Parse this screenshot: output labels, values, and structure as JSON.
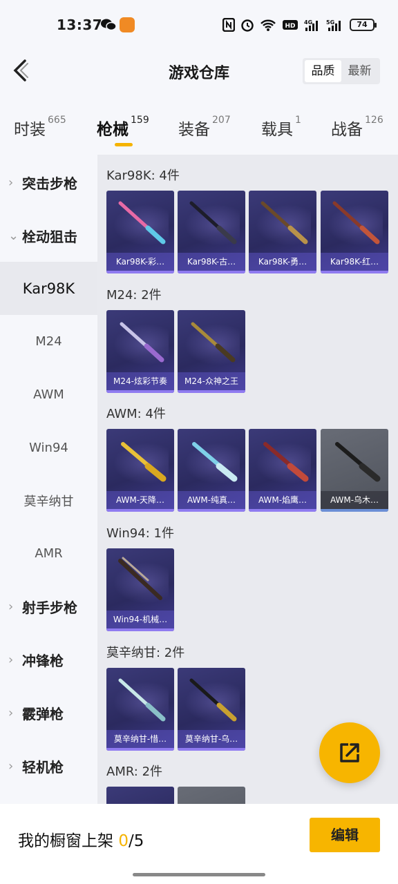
{
  "status_bar": {
    "time": "13:37",
    "battery": "74",
    "icons": [
      "wechat-icon",
      "fox-app-icon",
      "nfc-icon",
      "alarm-icon",
      "wifi-icon",
      "hd-icon",
      "signal-4g-icon",
      "signal-5g-icon",
      "battery-icon"
    ]
  },
  "header": {
    "title": "游戏仓库",
    "sort_quality": "品质",
    "sort_latest": "最新"
  },
  "tabs": [
    {
      "label": "时装",
      "count": "665"
    },
    {
      "label": "枪械",
      "count": "159"
    },
    {
      "label": "装备",
      "count": "207"
    },
    {
      "label": "载具",
      "count": "1"
    },
    {
      "label": "战备",
      "count": "126"
    }
  ],
  "sidebar": {
    "items": [
      {
        "label": "突击步枪",
        "type": "group",
        "expanded": false
      },
      {
        "label": "栓动狙击",
        "type": "group",
        "expanded": true
      },
      {
        "label": "Kar98K",
        "type": "sub",
        "active": true
      },
      {
        "label": "M24",
        "type": "sub"
      },
      {
        "label": "AWM",
        "type": "sub"
      },
      {
        "label": "Win94",
        "type": "sub"
      },
      {
        "label": "莫辛纳甘",
        "type": "sub"
      },
      {
        "label": "AMR",
        "type": "sub"
      },
      {
        "label": "射手步枪",
        "type": "group",
        "expanded": false
      },
      {
        "label": "冲锋枪",
        "type": "group",
        "expanded": false
      },
      {
        "label": "霰弹枪",
        "type": "group",
        "expanded": false
      },
      {
        "label": "轻机枪",
        "type": "group",
        "expanded": false
      }
    ]
  },
  "groups": [
    {
      "title": "Kar98K: 4件",
      "items": [
        "Kar98K-彩…",
        "Kar98K-古…",
        "Kar98K-勇…",
        "Kar98K-红…"
      ]
    },
    {
      "title": "M24: 2件",
      "items": [
        "M24-炫彩节奏",
        "M24-众神之王"
      ]
    },
    {
      "title": "AWM: 4件",
      "items": [
        "AWM-天降…",
        "AWM-纯真…",
        "AWM-焰鹰…",
        "AWM-乌木…"
      ]
    },
    {
      "title": "Win94: 1件",
      "items": [
        "Win94-机械…"
      ]
    },
    {
      "title": "莫辛纳甘: 2件",
      "items": [
        "莫辛纳甘-惜…",
        "莫辛纳甘-乌…"
      ]
    },
    {
      "title": "AMR: 2件",
      "items": [
        "",
        ""
      ]
    }
  ],
  "colors": {
    "accent": "#f7b500",
    "card_purple": "#2f2e66",
    "card_gray": "#5a5e68"
  },
  "bottom_bar": {
    "label": "我的橱窗上架",
    "count": "0",
    "total": "/5",
    "edit": "编辑"
  }
}
